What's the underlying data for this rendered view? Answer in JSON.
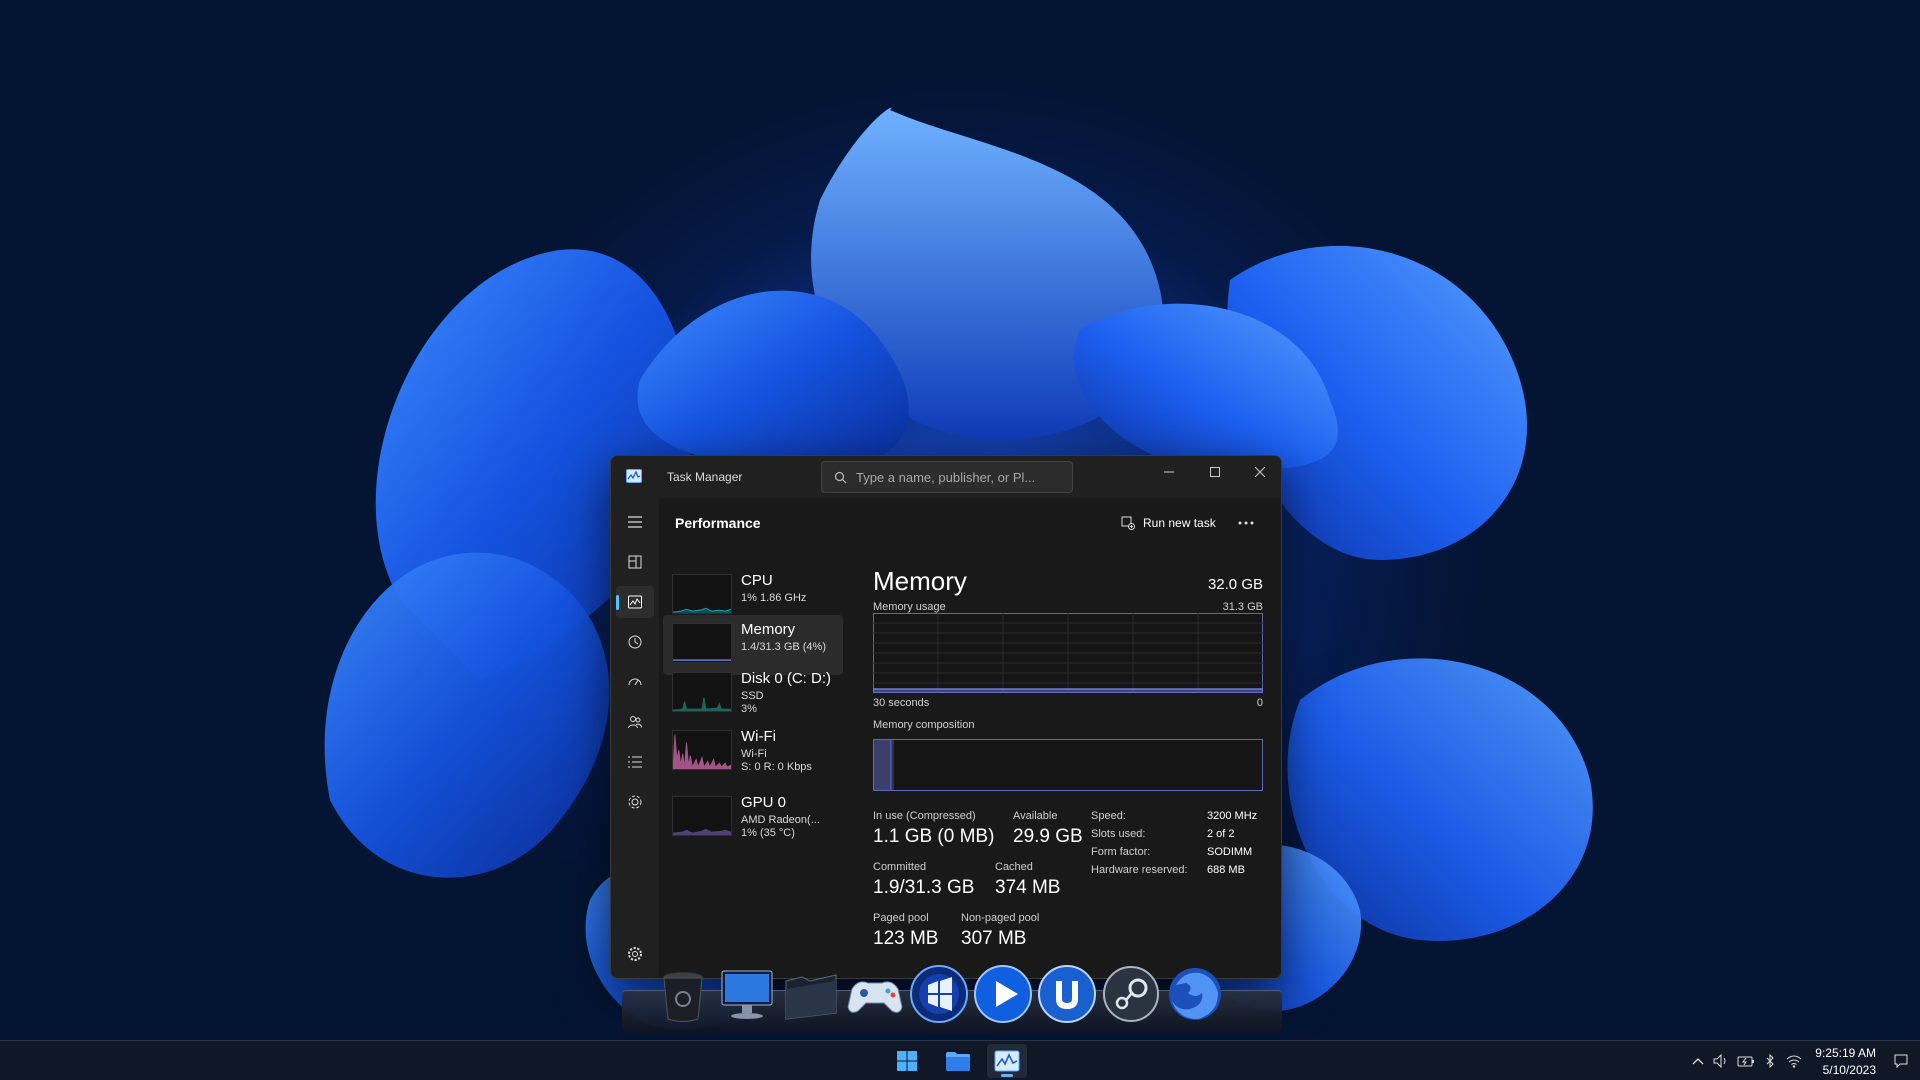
{
  "window": {
    "title": "Task Manager",
    "search_placeholder": "Type a name, publisher, or Pl..."
  },
  "nav": {
    "items": [
      "menu-icon",
      "processes-icon",
      "performance-icon",
      "app-history-icon",
      "startup-apps-icon",
      "users-icon",
      "details-icon",
      "services-icon",
      "settings-icon"
    ],
    "active": "performance-icon"
  },
  "header": {
    "title": "Performance",
    "run_new_task": "Run new task"
  },
  "perf_list": [
    {
      "name": "CPU",
      "sub1": "1% 1.86 GHz",
      "sub2": "",
      "sub3": "",
      "graph_color": "#17a3b8"
    },
    {
      "name": "Memory",
      "sub1": "1.4/31.3 GB (4%)",
      "sub2": "",
      "sub3": "",
      "graph_color": "#6f78d8",
      "selected": true
    },
    {
      "name": "Disk 0 (C: D:)",
      "sub1": "SSD",
      "sub2": "3%",
      "sub3": "",
      "graph_color": "#27b89a"
    },
    {
      "name": "Wi-Fi",
      "sub1": "Wi-Fi",
      "sub2": "S: 0 R: 0 Kbps",
      "sub3": "",
      "graph_color": "#e070b8"
    },
    {
      "name": "GPU 0",
      "sub1": "AMD Radeon(...",
      "sub2": "1% (35 °C)",
      "sub3": "",
      "graph_color": "#8f6cd6"
    }
  ],
  "memory": {
    "title": "Memory",
    "total": "32.0 GB",
    "usage_label": "Memory usage",
    "usage_max": "31.3 GB",
    "time_label": "30 seconds",
    "time_min": "0",
    "composition_label": "Memory composition",
    "in_use_fraction": 0.045,
    "stats": {
      "in_use_label": "In use (Compressed)",
      "in_use_value": "1.1 GB (0 MB)",
      "available_label": "Available",
      "available_value": "29.9 GB",
      "committed_label": "Committed",
      "committed_value": "1.9/31.3 GB",
      "cached_label": "Cached",
      "cached_value": "374 MB",
      "paged_label": "Paged pool",
      "paged_value": "123 MB",
      "nonpaged_label": "Non-paged pool",
      "nonpaged_value": "307 MB"
    },
    "specs": {
      "speed_label": "Speed:",
      "speed_value": "3200 MHz",
      "slots_label": "Slots used:",
      "slots_value": "2 of 2",
      "form_label": "Form factor:",
      "form_value": "SODIMM",
      "reserved_label": "Hardware reserved:",
      "reserved_value": "688 MB"
    }
  },
  "dock": [
    "recycle-bin-icon",
    "computer-icon",
    "folder-icon",
    "gamepad-icon",
    "bootcamp-icon",
    "media-player-icon",
    "utorrent-icon",
    "steam-icon",
    "firefox-icon"
  ],
  "taskbar": {
    "apps": [
      "windows-start-icon",
      "file-explorer-icon",
      "task-manager-icon"
    ],
    "time": "9:25:19 AM",
    "date": "5/10/2023"
  },
  "colors": {
    "accent": "#4cc2ff",
    "memory_line": "#6f78d8"
  }
}
